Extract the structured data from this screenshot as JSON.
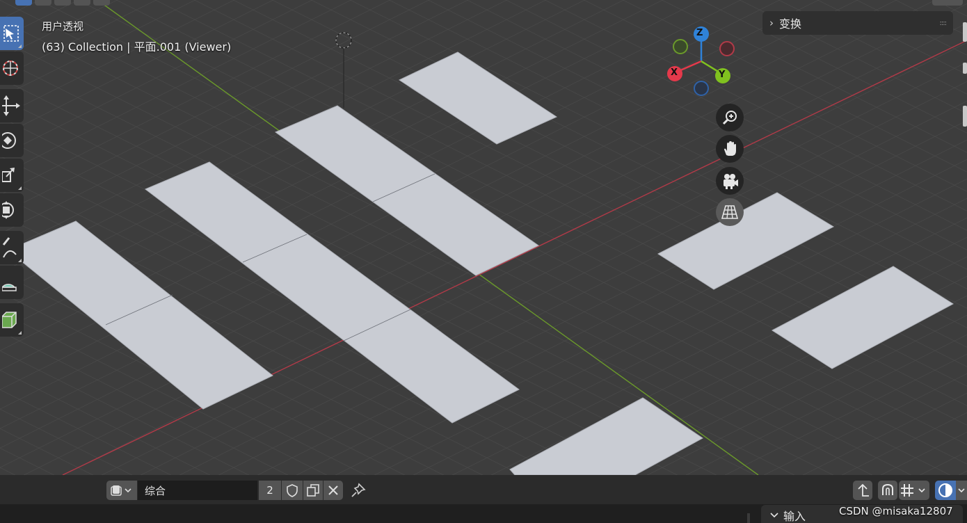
{
  "viewport": {
    "view_mode": "用户透视",
    "object_info": "(63) Collection | 平面.001 (Viewer)",
    "background_color": "#3d3d3d",
    "plane_color": "#c9ccd3",
    "x_axis_color": "#b23a48",
    "y_axis_color": "#6b9a2a"
  },
  "navigation_gizmo": {
    "axes": [
      "Z",
      "X",
      "Y"
    ],
    "colors": {
      "x": "#e5394b",
      "y": "#80c11f",
      "z": "#2f82d8"
    }
  },
  "toolbar": {
    "tools": [
      "select-box-icon",
      "cursor-icon",
      "move-icon",
      "rotate-icon",
      "scale-icon",
      "transform-icon",
      "annotate-icon",
      "measure-icon",
      "add-cube-icon"
    ],
    "active_tool": "select-box-icon"
  },
  "n_panel": {
    "transform_label": "变换"
  },
  "bottom_bar": {
    "action_name": "综合",
    "users_count": "2",
    "input_label": "输入",
    "overlay_color": "#4772b3"
  },
  "watermark": "CSDN @misaka12807"
}
